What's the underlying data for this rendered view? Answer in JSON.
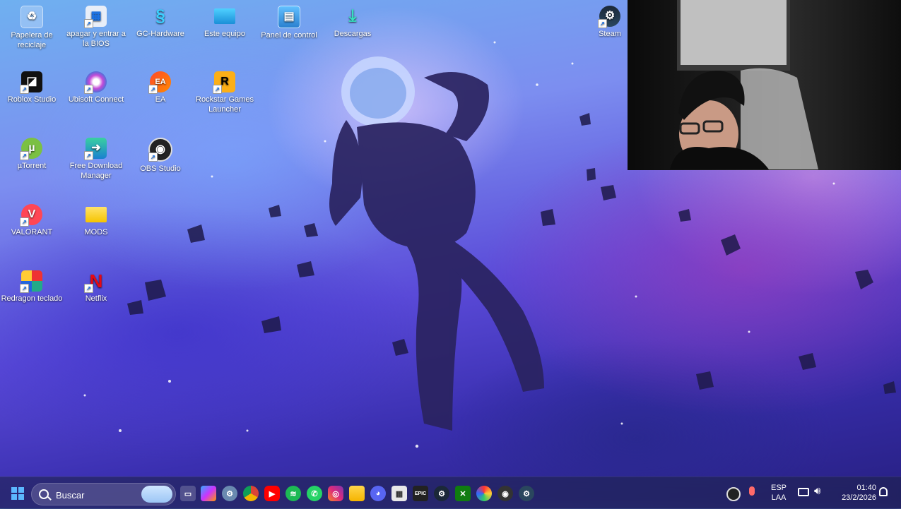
{
  "desktop": {
    "icons": [
      {
        "label": "Papelera de reciclaje",
        "icon": "recycle-bin-icon"
      },
      {
        "label": "apagar y entrar a la BIOS",
        "icon": "shortcut-icon"
      },
      {
        "label": "GC-Hardware",
        "icon": "gc-hardware-icon"
      },
      {
        "label": "Este equipo",
        "icon": "computer-icon"
      },
      {
        "label": "Panel de control",
        "icon": "control-panel-icon"
      },
      {
        "label": "Descargas",
        "icon": "downloads-icon"
      },
      {
        "label": "Steam",
        "icon": "steam-icon"
      },
      {
        "label": "Roblox Studio",
        "icon": "roblox-studio-icon"
      },
      {
        "label": "Ubisoft Connect",
        "icon": "ubisoft-icon"
      },
      {
        "label": "EA",
        "icon": "ea-icon"
      },
      {
        "label": "Rockstar Games Launcher",
        "icon": "rockstar-icon"
      },
      {
        "label": "µTorrent",
        "icon": "utorrent-icon"
      },
      {
        "label": "Free Download Manager",
        "icon": "fdm-icon"
      },
      {
        "label": "OBS Studio",
        "icon": "obs-icon"
      },
      {
        "label": "VALORANT",
        "icon": "valorant-icon"
      },
      {
        "label": "MODS",
        "icon": "folder-icon"
      },
      {
        "label": "Redragon teclado",
        "icon": "redragon-icon"
      },
      {
        "label": "Netflix",
        "icon": "netflix-icon"
      }
    ]
  },
  "taskbar": {
    "search_placeholder": "Buscar",
    "language": "ESP",
    "layout": "LAA",
    "time": "01:40",
    "date": "23/2/2026",
    "apps": [
      "task-view",
      "copilot",
      "settings",
      "chrome",
      "youtube",
      "spotify",
      "whatsapp",
      "instagram",
      "file-explorer",
      "discord",
      "calculator",
      "epic-games",
      "steam",
      "xbox",
      "color-app",
      "obs",
      "steam-alt"
    ]
  },
  "colors": {
    "taskbar_bg": "#1e2246",
    "accent": "#3aa0ff"
  }
}
